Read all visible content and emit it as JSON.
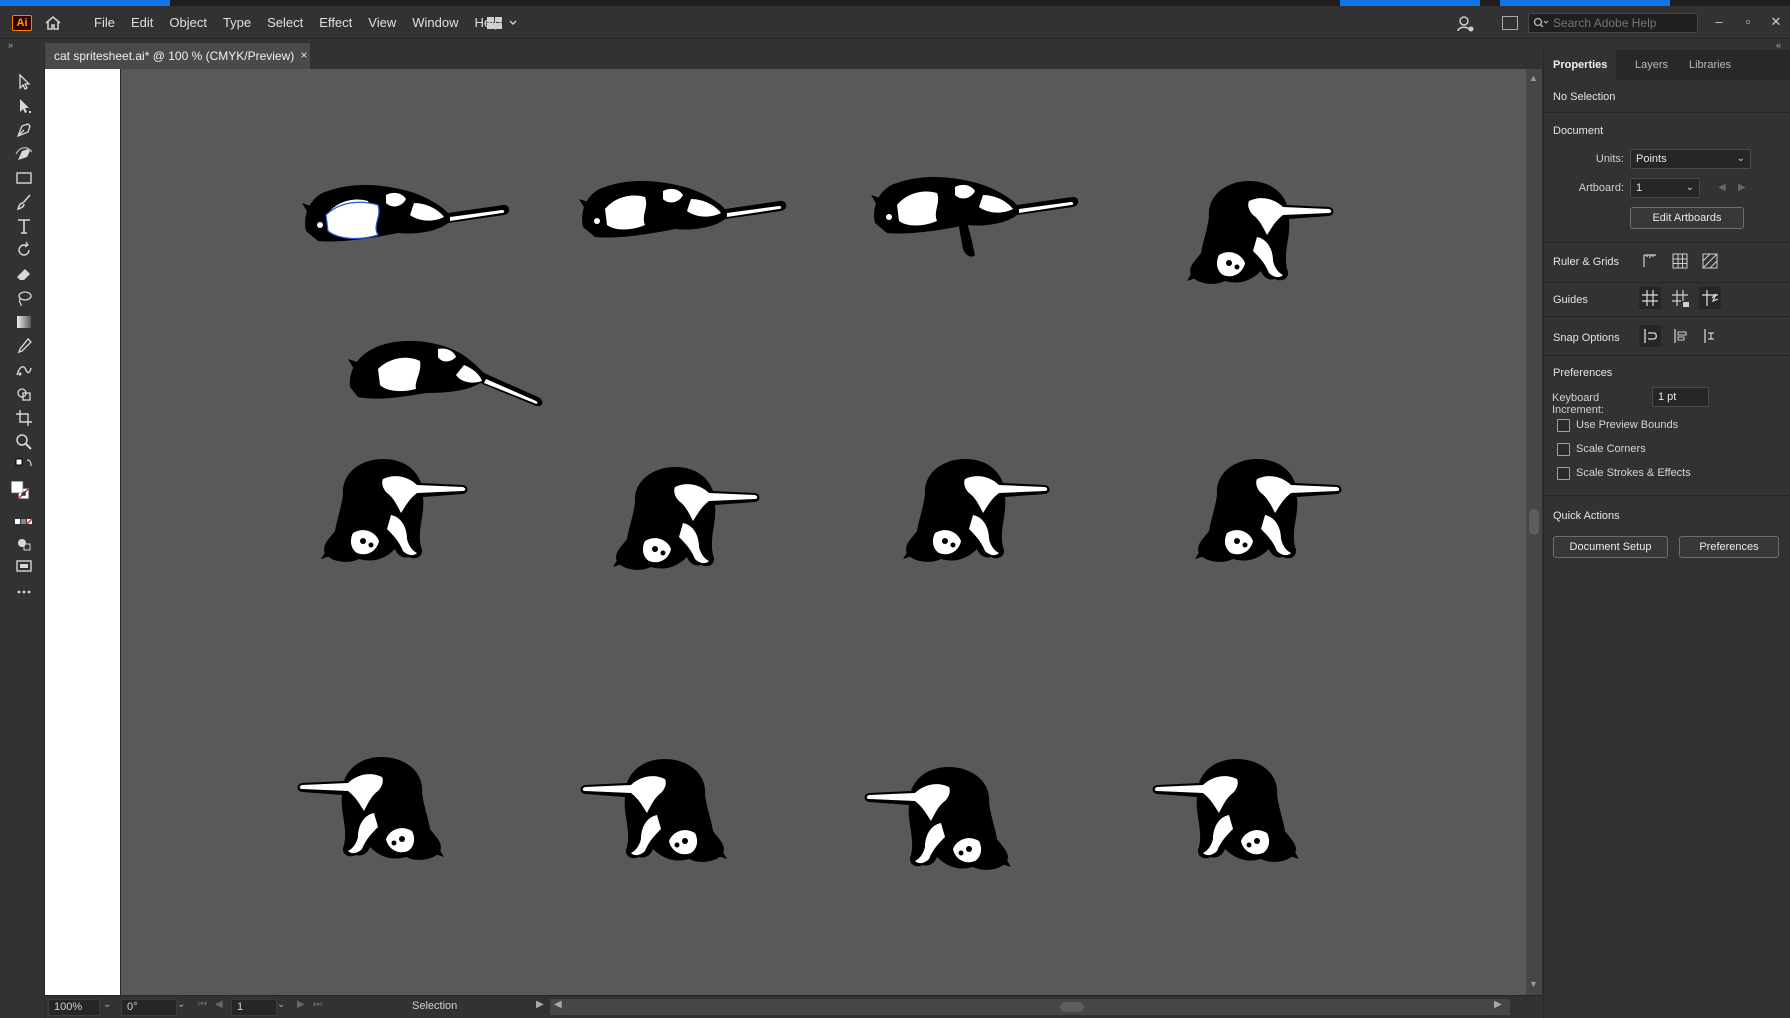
{
  "colors": {
    "canvas": "#595959",
    "chrome": "#323232",
    "panel_tab_bar": "#282828",
    "artboard": "#ffffff",
    "sprite_black": "#000000",
    "sprite_white": "#ffffff",
    "brand_orange": "#ff9a00",
    "taskbar_blue": "#1473e6"
  },
  "app": {
    "logo": "Ai",
    "menu": [
      "File",
      "Edit",
      "Object",
      "Type",
      "Select",
      "Effect",
      "View",
      "Window",
      "Help"
    ]
  },
  "search": {
    "placeholder": "Search Adobe Help"
  },
  "document": {
    "tab_title": "cat spritesheet.ai* @ 100 % (CMYK/Preview)",
    "close_glyph": "×"
  },
  "status": {
    "zoom": "100%",
    "rotation": "0°",
    "artboard_number": "1",
    "tool_name": "Selection"
  },
  "panel": {
    "tabs": [
      "Properties",
      "Layers",
      "Libraries"
    ],
    "no_selection": "No Selection",
    "document_heading": "Document",
    "units_label": "Units:",
    "units_value": "Points",
    "artboard_label": "Artboard:",
    "artboard_value": "1",
    "edit_artboards": "Edit Artboards",
    "ruler_grids": "Ruler & Grids",
    "guides": "Guides",
    "snap_options": "Snap Options",
    "preferences_heading": "Preferences",
    "keyboard_increment_label": "Keyboard Increment:",
    "keyboard_increment_value": "1 pt",
    "use_preview_bounds": "Use Preview Bounds",
    "scale_corners": "Scale Corners",
    "scale_strokes": "Scale Strokes & Effects",
    "quick_actions": "Quick Actions",
    "document_setup": "Document Setup",
    "preferences_button": "Preferences"
  },
  "tools": [
    "selection-tool-icon",
    "direct-selection-tool-icon",
    "pen-tool-icon",
    "curvature-tool-icon",
    "rectangle-tool-icon",
    "paintbrush-tool-icon",
    "type-tool-icon",
    "rotate-tool-icon",
    "eraser-tool-icon",
    "lasso-tool-icon",
    "gradient-tool-icon",
    "eyedropper-tool-icon",
    "blend-tool-icon",
    "shape-builder-tool-icon",
    "artboard-tool-icon",
    "zoom-tool-icon"
  ]
}
